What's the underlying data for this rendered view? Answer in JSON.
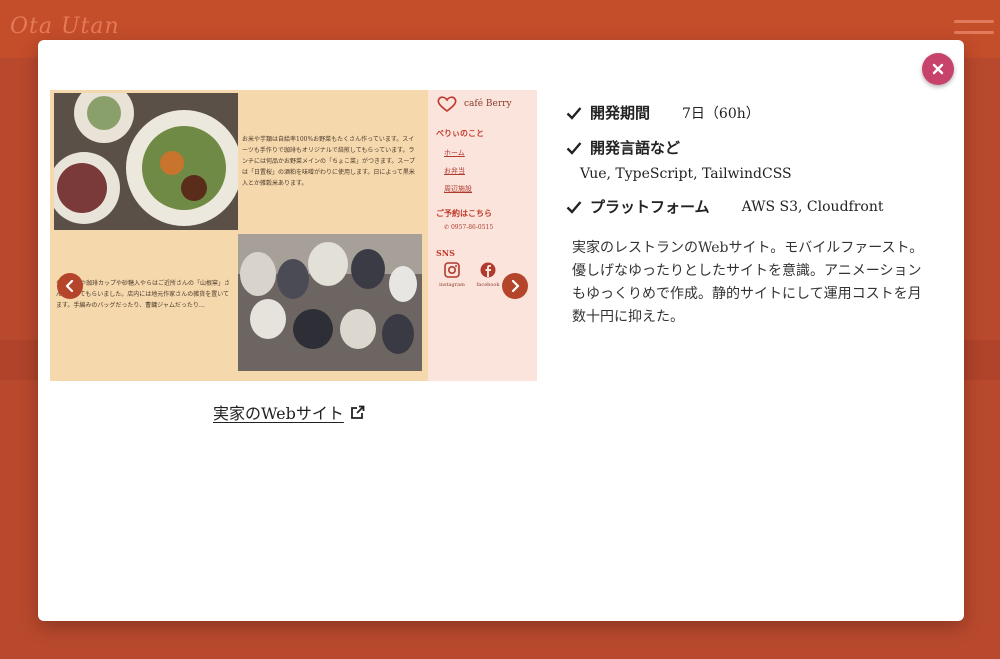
{
  "background": {
    "logo": "Ota Utan"
  },
  "modal": {
    "close_icon": "close-icon",
    "carousel": {
      "sidebar": {
        "brand": "café Berry",
        "section1": "べりぃのこと",
        "links": [
          "ホーム",
          "お弁当",
          "周辺施設"
        ],
        "section2": "ご予約はこちら",
        "tel": "0957-86-0515",
        "section3": "SNS",
        "social": [
          "instagram",
          "facebook"
        ]
      },
      "text1": "お米や芋類は自給率100%お野菜もたくさん作っています。スイーツも手作りで珈琲もオリジナルで焙煎してもらっています。ランチには何品かお野菜メインの「ちょこ菜」がつきます。スープは「日置桜」の酒粕を味噌がわりに使用します。日によって黒米入とか雑穀米あります。",
      "text2": "ケーキ皿や珈琲カップや砂糖入やらはご近所さんの「山根窯」さんで焼いてもらいました。店内には地元作家さんの雑貨を置いてます。手編みのバッグだったり、曹鏞ジャムだったり…",
      "prev_icon": "chevron-left-icon",
      "next_icon": "chevron-right-icon"
    },
    "link": {
      "label": "実家のWebサイト",
      "icon": "external-link-icon"
    },
    "details": {
      "period_label": "開発期間",
      "period_value": "7日（60h）",
      "lang_label": "開発言語など",
      "lang_value": "Vue, TypeScript, TailwindCSS",
      "platform_label": "プラットフォーム",
      "platform_value": "AWS S3, Cloudfront",
      "description": "実家のレストランのWebサイト。モバイルファースト。優しげなゆったりとしたサイトを意識。アニメーションもゆっくりめで作成。静的サイトにして運用コストを月数十円に抑えた。"
    }
  },
  "colors": {
    "accent": "#c8436b",
    "brand": "#b4452b"
  }
}
